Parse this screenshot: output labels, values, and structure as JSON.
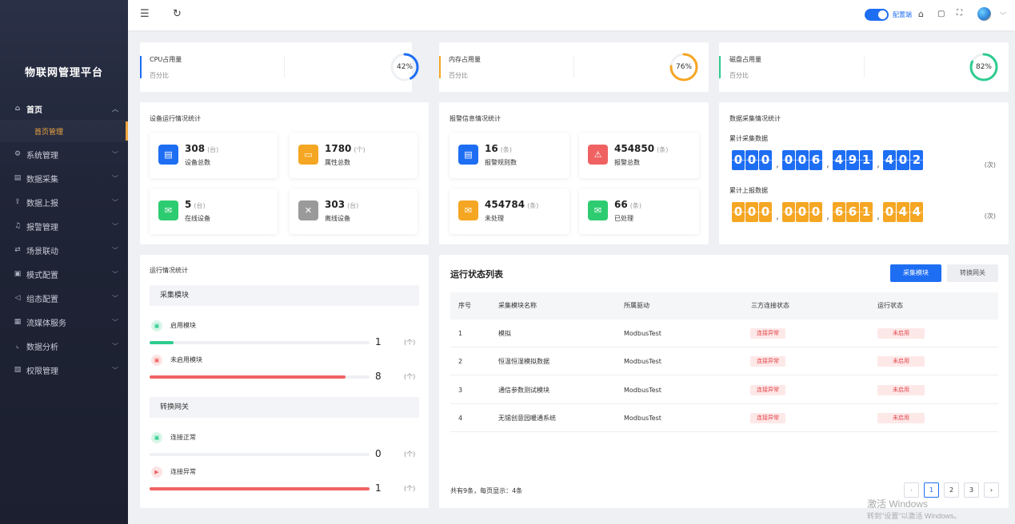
{
  "app": {
    "title": "物联网管理平台"
  },
  "sidebar": {
    "home": {
      "label": "首页"
    },
    "home_sub": {
      "label": "首页管理"
    },
    "items": [
      {
        "label": "系统管理",
        "icon": "gear-icon"
      },
      {
        "label": "数据采集",
        "icon": "grid-icon"
      },
      {
        "label": "数据上报",
        "icon": "upload-icon"
      },
      {
        "label": "报警管理",
        "icon": "bell-icon"
      },
      {
        "label": "场景联动",
        "icon": "link-icon"
      },
      {
        "label": "模式配置",
        "icon": "config-icon"
      },
      {
        "label": "组态配置",
        "icon": "megaphone-icon"
      },
      {
        "label": "流媒体服务",
        "icon": "media-icon"
      },
      {
        "label": "数据分析",
        "icon": "chart-icon"
      },
      {
        "label": "权限管理",
        "icon": "permission-icon"
      }
    ]
  },
  "header": {
    "mode_label": "配置端"
  },
  "usage": [
    {
      "title": "CPU占用量",
      "sub": "百分比",
      "value": "42%",
      "percent": 42,
      "color": "#1e6ef4"
    },
    {
      "title": "内存占用量",
      "sub": "百分比",
      "value": "76%",
      "percent": 76,
      "color": "#f5a623"
    },
    {
      "title": "磁盘占用量",
      "sub": "百分比",
      "value": "82%",
      "percent": 82,
      "color": "#2ecc8f"
    }
  ],
  "device": {
    "title": "设备运行情况统计",
    "stats": [
      {
        "value": "308",
        "unit": "(台)",
        "label": "设备总数",
        "color": "#1e6ef4",
        "icon": "device-icon"
      },
      {
        "value": "1780",
        "unit": "(个)",
        "label": "属性总数",
        "color": "#f5a623",
        "icon": "attribute-icon"
      },
      {
        "value": "5",
        "unit": "(台)",
        "label": "在线设备",
        "color": "#2ecc71",
        "icon": "online-icon"
      },
      {
        "value": "303",
        "unit": "(台)",
        "label": "离线设备",
        "color": "#9a9a9a",
        "icon": "offline-icon"
      }
    ]
  },
  "alarm": {
    "title": "报警信息情况统计",
    "stats": [
      {
        "value": "16",
        "unit": "(条)",
        "label": "报警规则数",
        "color": "#1e6ef4",
        "icon": "rule-icon"
      },
      {
        "value": "454850",
        "unit": "(条)",
        "label": "报警总数",
        "color": "#f06262",
        "icon": "alarm-icon"
      },
      {
        "value": "454784",
        "unit": "(条)",
        "label": "未处理",
        "color": "#f5a623",
        "icon": "unhandled-icon"
      },
      {
        "value": "66",
        "unit": "(条)",
        "label": "已处理",
        "color": "#2ecc71",
        "icon": "handled-icon"
      }
    ]
  },
  "collect": {
    "title": "数据采集情况统计",
    "total_label": "累计采集数据",
    "total_digits": [
      "0",
      "0",
      "0",
      ",",
      "0",
      "0",
      "6",
      ",",
      "4",
      "9",
      "1",
      ",",
      "4",
      "0",
      "2"
    ],
    "report_label": "累计上报数据",
    "report_digits": [
      "0",
      "0",
      "0",
      ",",
      "0",
      "0",
      "0",
      ",",
      "6",
      "6",
      "1",
      ",",
      "0",
      "4",
      "4"
    ],
    "unit": "(次)"
  },
  "running": {
    "title": "运行情况统计",
    "sections": [
      {
        "title": "采集模块",
        "items": [
          {
            "label": "启用模块",
            "value": "1",
            "unit": "(个)",
            "fraction": 0.11,
            "color": "#2ecc8f"
          },
          {
            "label": "未启用模块",
            "value": "8",
            "unit": "(个)",
            "fraction": 0.89,
            "color": "#f06262"
          }
        ]
      },
      {
        "title": "转换网关",
        "items": [
          {
            "label": "连接正常",
            "value": "0",
            "unit": "(个)",
            "fraction": 0,
            "color": "#2ecc8f"
          },
          {
            "label": "连接异常",
            "value": "1",
            "unit": "(个)",
            "fraction": 1,
            "color": "#f06262"
          }
        ]
      }
    ]
  },
  "table": {
    "title": "运行状态列表",
    "tabs": [
      "采集模块",
      "转换网关"
    ],
    "columns": [
      "序号",
      "采集模块名称",
      "所属驱动",
      "三方连接状态",
      "运行状态"
    ],
    "rows": [
      [
        "1",
        "模拟",
        "ModbusTest",
        "连接异常",
        "未启用"
      ],
      [
        "2",
        "恒温恒湿模拟数据",
        "ModbusTest",
        "连接异常",
        "未启用"
      ],
      [
        "3",
        "通信参数测试模块",
        "ModbusTest",
        "连接异常",
        "未启用"
      ],
      [
        "4",
        "无锡创意园暖通系统",
        "ModbusTest",
        "连接异常",
        "未启用"
      ]
    ],
    "footer": "共有9条，每页显示：4条",
    "pagination": {
      "prev": "‹",
      "pages": [
        "1",
        "2",
        "3"
      ],
      "next": "›",
      "current": "1"
    }
  },
  "watermark": {
    "line1": "激活 Windows",
    "line2": "转到\"设置\"以激活 Windows。"
  }
}
